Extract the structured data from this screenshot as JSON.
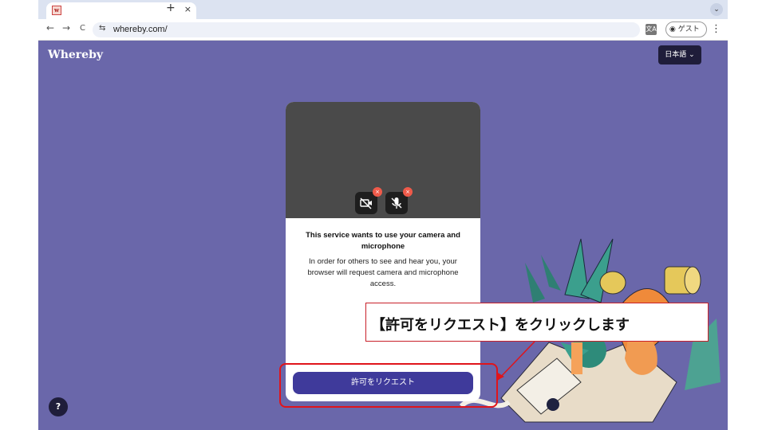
{
  "browser": {
    "favicon_letter": "w",
    "tab_close": "×",
    "new_tab": "+",
    "tabs_menu": "⌄",
    "back": "←",
    "forward": "→",
    "reload": "C",
    "site_info": "⇆",
    "url": "whereby.com/",
    "translate": "文A",
    "guest_label": "ゲスト",
    "menu": "⋮"
  },
  "page": {
    "logo": "Whereby",
    "language_button": "日本語 ⌄",
    "help_button": "?"
  },
  "dialog": {
    "title": "This service wants to use your camera and microphone",
    "body": "In order for others to see and hear you, your browser will request camera and microphone access.",
    "request_button": "許可をリクエスト",
    "camera_badge": "×",
    "mic_badge": "×"
  },
  "annotation": {
    "callout_text": "【許可をリクエスト】をクリックします",
    "highlight_color": "#e0141b"
  },
  "colors": {
    "page_bg": "#6a67aa",
    "button_bg": "#3f3a9b",
    "preview_bg": "#4a4a4a",
    "error_badge": "#ef5a4a"
  }
}
